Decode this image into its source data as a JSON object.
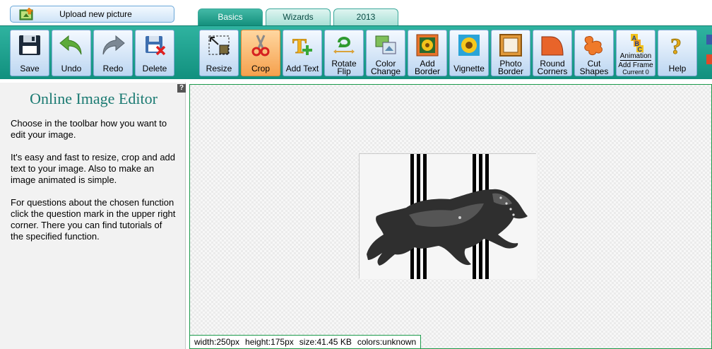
{
  "upload": {
    "label": "Upload new picture",
    "icon": "upload-picture-icon"
  },
  "tabs": [
    {
      "label": "Basics",
      "active": true
    },
    {
      "label": "Wizards",
      "active": false
    },
    {
      "label": "2013",
      "active": false
    }
  ],
  "toolbar": {
    "save": "Save",
    "undo": "Undo",
    "redo": "Redo",
    "delete": "Delete",
    "resize": "Resize",
    "crop": "Crop",
    "add_text": "Add Text",
    "rotate_1": "Rotate",
    "rotate_2": "Flip",
    "color_1": "Color",
    "color_2": "Change",
    "border_1": "Add",
    "border_2": "Border",
    "vignette": "Vignette",
    "photo_1": "Photo",
    "photo_2": "Border",
    "round_1": "Round",
    "round_2": "Corners",
    "cut_1": "Cut",
    "cut_2": "Shapes",
    "anim_a": "Animation",
    "anim_b": "Add Frame",
    "anim_c": "Current 0",
    "anim_letters": [
      "A",
      "B",
      "C"
    ],
    "help": "Help",
    "active_tool": "crop"
  },
  "left": {
    "help_mark": "?",
    "title": "Online Image Editor",
    "p1": "Choose in the toolbar how you want to edit your image.",
    "p2": "It's easy and fast to resize, crop and add text to your image. Also to make an image animated is simple.",
    "p3": "For questions about the chosen function click the question mark in the upper right corner. There you can find tutorials of the specified function."
  },
  "status": {
    "width": "width:250px",
    "height": "height:175px",
    "size": "size:41.45 KB",
    "colors": "colors:unknown"
  },
  "colors": {
    "teal": "#14907d",
    "accent_orange": "#f5a14e",
    "title_teal": "#1a7a72",
    "canvas_border": "#1c9a4b"
  }
}
